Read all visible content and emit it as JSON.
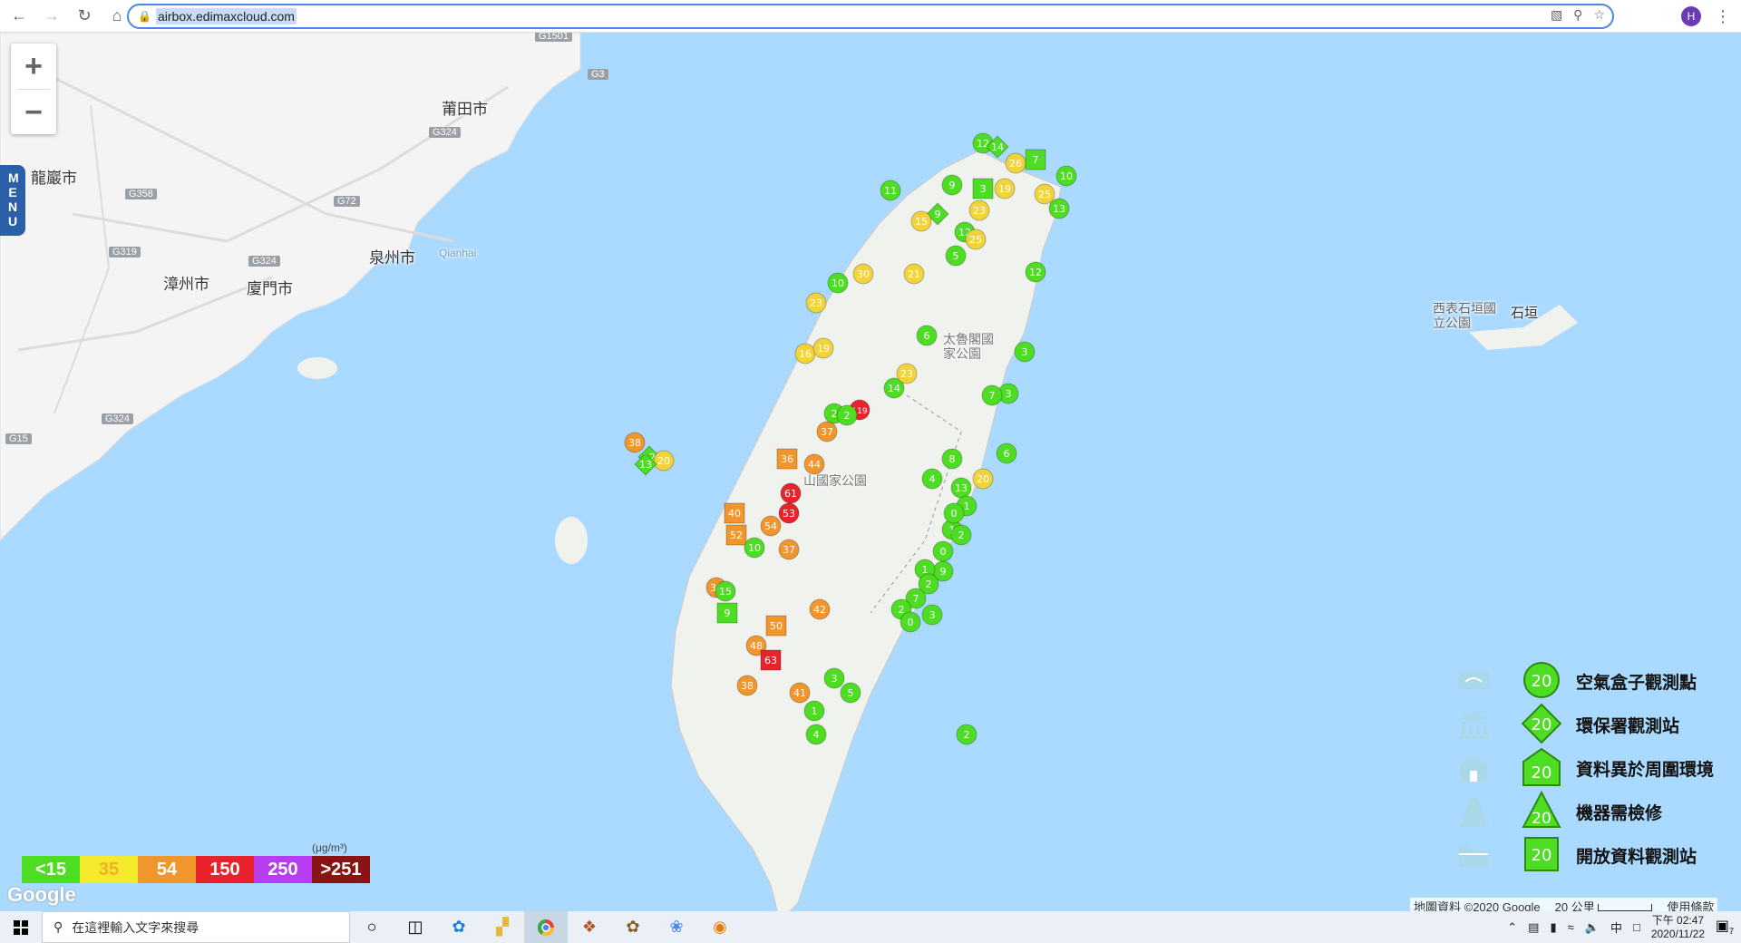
{
  "browser": {
    "url": "airbox.edimaxcloud.com",
    "profile_initial": "H"
  },
  "map": {
    "labels": [
      {
        "name": "label-putian",
        "text": "莆田市"
      },
      {
        "name": "label-longyan",
        "text": "龍巖市"
      },
      {
        "name": "label-quanzhou",
        "text": "泉州市"
      },
      {
        "name": "label-qianhai",
        "text": "Qianhai"
      },
      {
        "name": "label-zhangzhou",
        "text": "漳州市"
      },
      {
        "name": "label-xiamen",
        "text": "廈門市"
      },
      {
        "name": "label-taroko",
        "text": "太魯閣國家公園"
      },
      {
        "name": "label-yushan",
        "text": "山國家公園"
      },
      {
        "name": "label-xibiao",
        "text": "西表石垣國立公園"
      },
      {
        "name": "label-ishigaki",
        "text": "石垣"
      }
    ],
    "highways": [
      "G1501",
      "G3",
      "G324",
      "G358",
      "G72",
      "G319",
      "G324",
      "G324",
      "G15"
    ],
    "menu_label": "MENU",
    "stations": [
      {
        "v": 12,
        "t": "c",
        "c": "#4ddd23"
      },
      {
        "v": 14,
        "t": "d",
        "c": "#4ddd23"
      },
      {
        "v": 26,
        "t": "c",
        "c": "#f2d33a"
      },
      {
        "v": 7,
        "t": "s",
        "c": "#4ddd23"
      },
      {
        "v": 11,
        "t": "c",
        "c": "#4ddd23"
      },
      {
        "v": 10,
        "t": "c",
        "c": "#4ddd23"
      },
      {
        "v": 9,
        "t": "c",
        "c": "#4ddd23"
      },
      {
        "v": 3,
        "t": "s",
        "c": "#4ddd23"
      },
      {
        "v": 19,
        "t": "c",
        "c": "#f2d33a"
      },
      {
        "v": 25,
        "t": "c",
        "c": "#f2d33a"
      },
      {
        "v": 13,
        "t": "c",
        "c": "#4ddd23"
      },
      {
        "v": 9,
        "t": "d",
        "c": "#4ddd23"
      },
      {
        "v": 12,
        "t": "c",
        "c": "#4ddd23"
      },
      {
        "v": 15,
        "t": "c",
        "c": "#f2d33a"
      },
      {
        "v": 5,
        "t": "c",
        "c": "#4ddd23"
      },
      {
        "v": 30,
        "t": "c",
        "c": "#f2d33a"
      },
      {
        "v": 21,
        "t": "c",
        "c": "#f2d33a"
      },
      {
        "v": 10,
        "t": "c",
        "c": "#4ddd23"
      },
      {
        "v": 23,
        "t": "c",
        "c": "#f2d33a"
      },
      {
        "v": 16,
        "t": "c",
        "c": "#f2d33a"
      },
      {
        "v": 19,
        "t": "c",
        "c": "#f2d33a"
      },
      {
        "v": 2,
        "t": "c",
        "c": "#4ddd23"
      },
      {
        "v": 6,
        "t": "c",
        "c": "#4ddd23"
      },
      {
        "v": 119,
        "t": "c",
        "c": "#e8232c"
      },
      {
        "v": 14,
        "t": "c",
        "c": "#4ddd23"
      },
      {
        "v": 23,
        "t": "c",
        "c": "#f2d33a"
      },
      {
        "v": 37,
        "t": "c",
        "c": "#f0962c"
      },
      {
        "v": 2,
        "t": "c",
        "c": "#4ddd23"
      },
      {
        "v": 36,
        "t": "s",
        "c": "#f0962c"
      },
      {
        "v": 44,
        "t": "c",
        "c": "#f0962c"
      },
      {
        "v": 61,
        "t": "c",
        "c": "#e8232c"
      },
      {
        "v": 53,
        "t": "c",
        "c": "#e8232c"
      },
      {
        "v": 40,
        "t": "s",
        "c": "#f0962c"
      },
      {
        "v": 54,
        "t": "c",
        "c": "#f0962c"
      },
      {
        "v": 52,
        "t": "s",
        "c": "#f0962c"
      },
      {
        "v": 10,
        "t": "c",
        "c": "#4ddd23"
      },
      {
        "v": 37,
        "t": "c",
        "c": "#f0962c"
      },
      {
        "v": 39,
        "t": "c",
        "c": "#f0962c"
      },
      {
        "v": 15,
        "t": "c",
        "c": "#4ddd23"
      },
      {
        "v": 9,
        "t": "s",
        "c": "#4ddd23"
      },
      {
        "v": 42,
        "t": "c",
        "c": "#f0962c"
      },
      {
        "v": 50,
        "t": "s",
        "c": "#f0962c"
      },
      {
        "v": 48,
        "t": "c",
        "c": "#f0962c"
      },
      {
        "v": 63,
        "t": "s",
        "c": "#e8232c"
      },
      {
        "v": 38,
        "t": "c",
        "c": "#f0962c"
      },
      {
        "v": 41,
        "t": "c",
        "c": "#f0962c"
      },
      {
        "v": 3,
        "t": "c",
        "c": "#4ddd23"
      },
      {
        "v": 5,
        "t": "c",
        "c": "#4ddd23"
      },
      {
        "v": 1,
        "t": "c",
        "c": "#4ddd23"
      },
      {
        "v": 4,
        "t": "c",
        "c": "#4ddd23"
      },
      {
        "v": 2,
        "t": "c",
        "c": "#4ddd23"
      },
      {
        "v": 4,
        "t": "c",
        "c": "#4ddd23"
      },
      {
        "v": 8,
        "t": "c",
        "c": "#4ddd23"
      },
      {
        "v": 13,
        "t": "c",
        "c": "#4ddd23"
      },
      {
        "v": 1,
        "t": "c",
        "c": "#4ddd23"
      },
      {
        "v": 9,
        "t": "c",
        "c": "#4ddd23"
      },
      {
        "v": 38,
        "t": "c",
        "c": "#f0962c"
      },
      {
        "v": 12,
        "t": "d",
        "c": "#4ddd23"
      },
      {
        "v": 20,
        "t": "c",
        "c": "#f2d33a"
      },
      {
        "v": 13,
        "t": "d",
        "c": "#4ddd23"
      },
      {
        "v": 3,
        "t": "c",
        "c": "#4ddd23"
      },
      {
        "v": 20,
        "t": "c",
        "c": "#f2d33a"
      },
      {
        "v": 6,
        "t": "c",
        "c": "#4ddd23"
      },
      {
        "v": 1,
        "t": "c",
        "c": "#4ddd23"
      },
      {
        "v": 0,
        "t": "c",
        "c": "#4ddd23"
      },
      {
        "v": 2,
        "t": "c",
        "c": "#4ddd23"
      },
      {
        "v": 0,
        "t": "c",
        "c": "#4ddd23"
      },
      {
        "v": 1,
        "t": "c",
        "c": "#4ddd23"
      },
      {
        "v": 2,
        "t": "c",
        "c": "#4ddd23"
      },
      {
        "v": 7,
        "t": "c",
        "c": "#4ddd23"
      },
      {
        "v": 2,
        "t": "c",
        "c": "#4ddd23"
      },
      {
        "v": 3,
        "t": "c",
        "c": "#4ddd23"
      },
      {
        "v": 0,
        "t": "c",
        "c": "#4ddd23"
      },
      {
        "v": 3,
        "t": "c",
        "c": "#4ddd23"
      },
      {
        "v": 7,
        "t": "c",
        "c": "#4ddd23"
      },
      {
        "v": 12,
        "t": "c",
        "c": "#4ddd23"
      },
      {
        "v": 23,
        "t": "c",
        "c": "#f2d33a"
      },
      {
        "v": 25,
        "t": "c",
        "c": "#f2d33a"
      }
    ]
  },
  "legend": {
    "items": [
      {
        "label": "空氣盒子觀測點",
        "value": "20",
        "shape": "circle"
      },
      {
        "label": "環保署觀測站",
        "value": "20",
        "shape": "diamond"
      },
      {
        "label": "資料異於周圍環境",
        "value": "20",
        "shape": "house"
      },
      {
        "label": "機器需檢修",
        "value": "20",
        "shape": "triangle"
      },
      {
        "label": "開放資料觀測站",
        "value": "20",
        "shape": "square"
      }
    ]
  },
  "scale": {
    "unit": "(μg/m³)",
    "cells": [
      {
        "label": "<15",
        "color": "#4ddd23",
        "text_color": "#ffffff"
      },
      {
        "label": "35",
        "color": "#f5ea2b",
        "text_color": "#f0b02c"
      },
      {
        "label": "54",
        "color": "#f0962c",
        "text_color": "#ffffff"
      },
      {
        "label": "150",
        "color": "#e8232c",
        "text_color": "#ffffff"
      },
      {
        "label": "250",
        "color": "#b83df0",
        "text_color": "#ffffff"
      },
      {
        "label": ">251",
        "color": "#8a1414",
        "text_color": "#ffffff"
      }
    ]
  },
  "footer": {
    "google": "Google",
    "attribution": "地圖資料 ©2020 Google",
    "distance": "20 公里",
    "terms": "使用條款"
  },
  "taskbar": {
    "search_placeholder": "在這裡輸入文字來搜尋",
    "ime": "中",
    "time": "下午 02:47",
    "date": "2020/11/22",
    "notifications": "7"
  }
}
